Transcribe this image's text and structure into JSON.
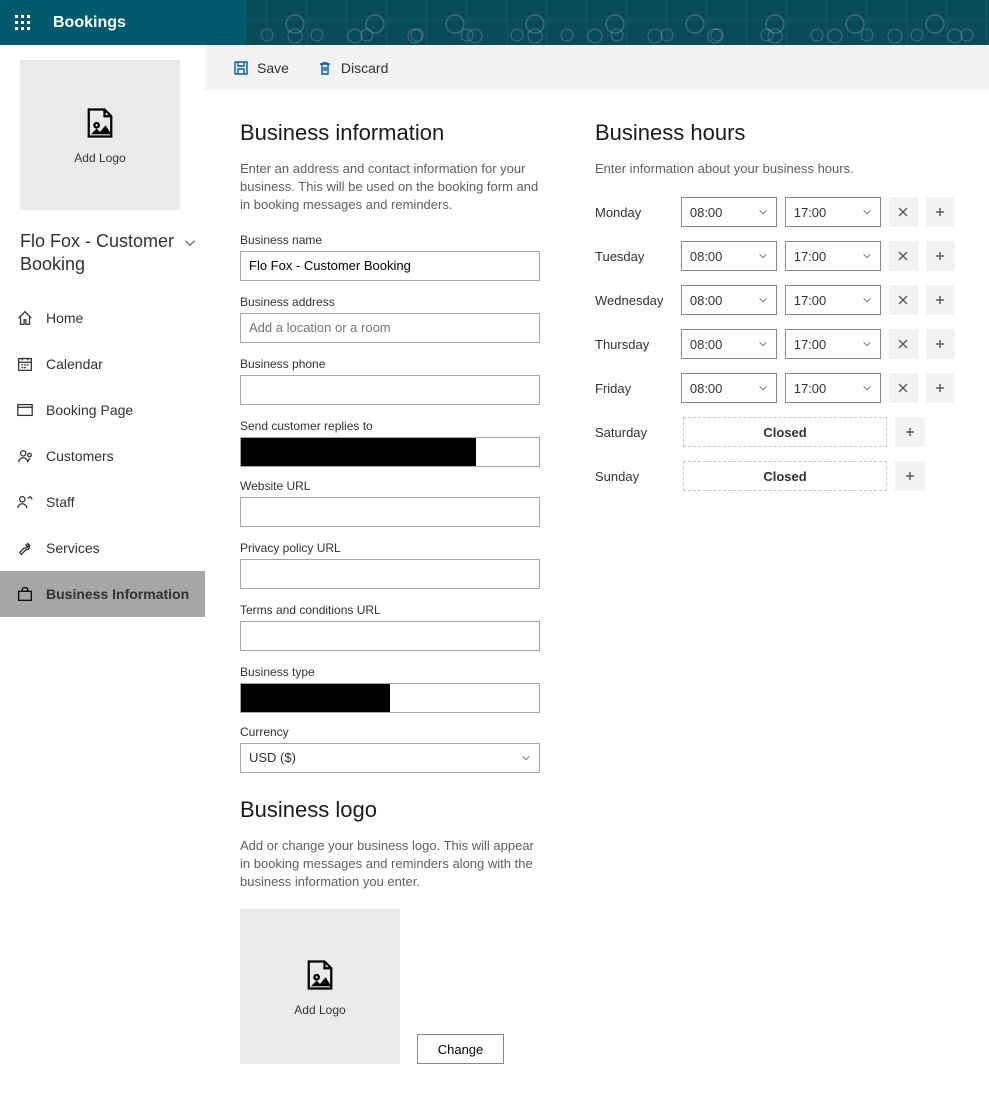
{
  "header": {
    "app_name": "Bookings"
  },
  "sidebar": {
    "logo_tile_label": "Add Logo",
    "calendar_title": "Flo Fox - Customer Booking",
    "nav": [
      {
        "label": "Home"
      },
      {
        "label": "Calendar"
      },
      {
        "label": "Booking Page"
      },
      {
        "label": "Customers"
      },
      {
        "label": "Staff"
      },
      {
        "label": "Services"
      },
      {
        "label": "Business Information"
      }
    ]
  },
  "cmdbar": {
    "save": "Save",
    "discard": "Discard"
  },
  "biz_info": {
    "heading": "Business information",
    "hint": "Enter an address and contact information for your business. This will be used on the booking form and in booking messages and reminders.",
    "labels": {
      "name": "Business name",
      "address": "Business address",
      "phone": "Business phone",
      "replies": "Send customer replies to",
      "website": "Website URL",
      "privacy": "Privacy policy URL",
      "terms": "Terms and conditions URL",
      "type": "Business type",
      "currency": "Currency"
    },
    "values": {
      "name": "Flo Fox - Customer Booking",
      "address": "",
      "address_placeholder": "Add a location or a room",
      "phone": "",
      "replies": "",
      "website": "",
      "privacy": "",
      "terms": "",
      "type": "",
      "currency": "USD ($)"
    }
  },
  "biz_logo": {
    "heading": "Business logo",
    "hint": "Add or change your business logo. This will appear in booking messages and reminders along with the business information you enter.",
    "tile_label": "Add Logo",
    "change_label": "Change"
  },
  "hours": {
    "heading": "Business hours",
    "hint": "Enter information about your business hours.",
    "closed_label": "Closed",
    "rows": [
      {
        "day": "Monday",
        "start": "08:00",
        "end": "17:00",
        "closed": false
      },
      {
        "day": "Tuesday",
        "start": "08:00",
        "end": "17:00",
        "closed": false
      },
      {
        "day": "Wednesday",
        "start": "08:00",
        "end": "17:00",
        "closed": false
      },
      {
        "day": "Thursday",
        "start": "08:00",
        "end": "17:00",
        "closed": false
      },
      {
        "day": "Friday",
        "start": "08:00",
        "end": "17:00",
        "closed": false
      },
      {
        "day": "Saturday",
        "closed": true
      },
      {
        "day": "Sunday",
        "closed": true
      }
    ]
  }
}
